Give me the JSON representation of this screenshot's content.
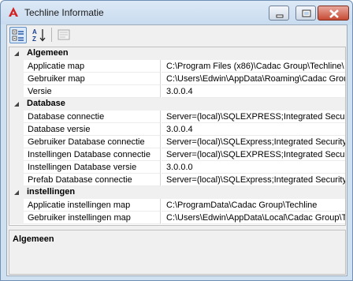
{
  "window": {
    "title": "Techline Informatie",
    "controls": {
      "minimize": "minimize",
      "maximize": "maximize",
      "close": "close"
    }
  },
  "toolbar": {
    "buttons": [
      {
        "icon": "categorized-icon",
        "active": true
      },
      {
        "icon": "alphabetical-sort-icon",
        "active": false
      },
      {
        "icon": "property-pages-icon",
        "active": false
      }
    ]
  },
  "grid": {
    "categories": [
      {
        "label": "Algemeen",
        "rows": [
          {
            "name": "Applicatie map",
            "value": "C:\\Program Files (x86)\\Cadac Group\\Techline\\"
          },
          {
            "name": "Gebruiker map",
            "value": "C:\\Users\\Edwin\\AppData\\Roaming\\Cadac Group\\"
          },
          {
            "name": "Versie",
            "value": "3.0.0.4"
          }
        ]
      },
      {
        "label": "Database",
        "rows": [
          {
            "name": "Database connectie",
            "value": "Server=(local)\\SQLEXPRESS;Integrated Security="
          },
          {
            "name": "Database versie",
            "value": "3.0.0.4"
          },
          {
            "name": "Gebruiker Database connectie",
            "value": "Server=(local)\\SQLExpress;Integrated Security=tru"
          },
          {
            "name": "Instellingen Database connectie",
            "value": "Server=(local)\\SQLEXPRESS;Integrated Security="
          },
          {
            "name": "Instellingen Database versie",
            "value": "3.0.0.0"
          },
          {
            "name": "Prefab Database connectie",
            "value": "Server=(local)\\SQLExpress;Integrated Security=SS"
          }
        ]
      },
      {
        "label": "instellingen",
        "rows": [
          {
            "name": "Applicatie instellingen map",
            "value": "C:\\ProgramData\\Cadac Group\\Techline"
          },
          {
            "name": "Gebruiker instellingen map",
            "value": "C:\\Users\\Edwin\\AppData\\Local\\Cadac Group\\Te"
          }
        ]
      }
    ]
  },
  "description": {
    "title": "Algemeen"
  }
}
